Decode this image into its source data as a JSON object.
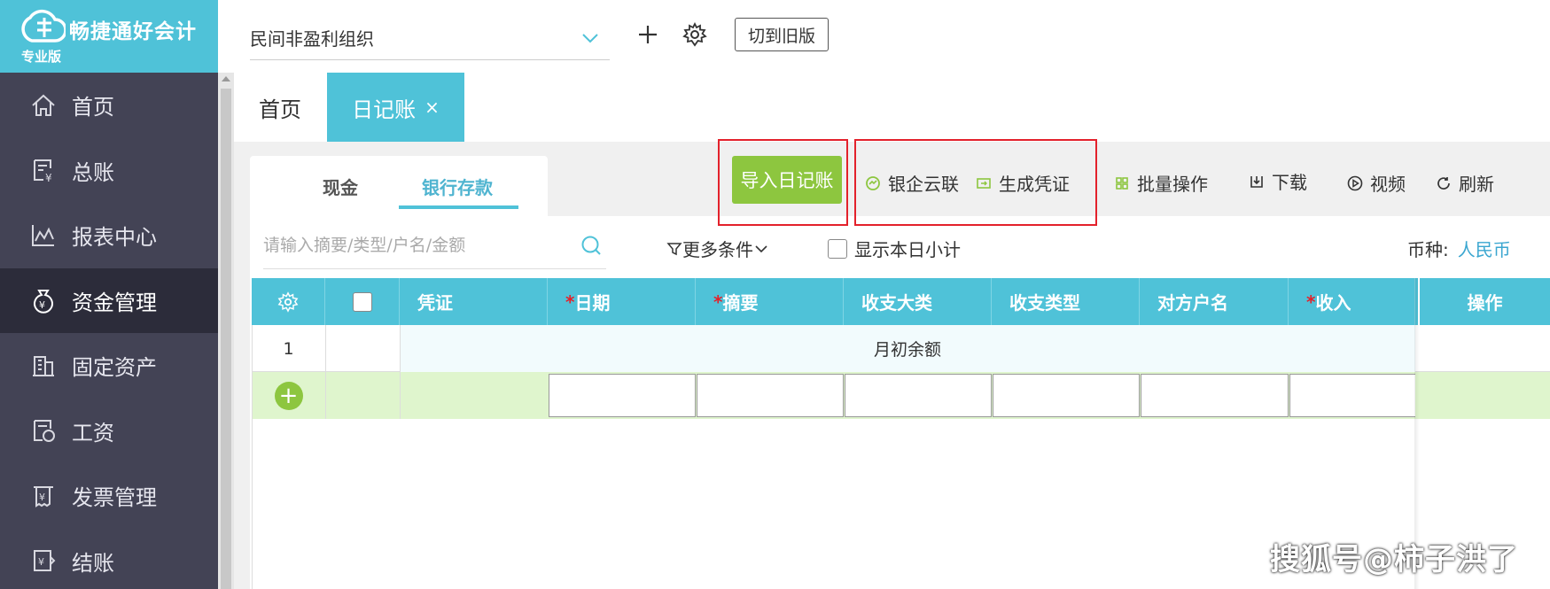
{
  "brand": {
    "name": "畅捷通好会计",
    "edition": "专业版"
  },
  "sidebar": {
    "items": [
      {
        "label": "首页",
        "icon": "home-icon"
      },
      {
        "label": "总账",
        "icon": "ledger-icon"
      },
      {
        "label": "报表中心",
        "icon": "chart-icon"
      },
      {
        "label": "资金管理",
        "icon": "money-bag-icon",
        "active": true
      },
      {
        "label": "固定资产",
        "icon": "building-icon"
      },
      {
        "label": "工资",
        "icon": "salary-icon"
      },
      {
        "label": "发票管理",
        "icon": "invoice-icon"
      },
      {
        "label": "结账",
        "icon": "closing-icon"
      }
    ]
  },
  "topbar": {
    "org_name": "民间非盈利组织",
    "old_version_label": "切到旧版"
  },
  "tabs": {
    "home": "首页",
    "journal": "日记账",
    "close": "×"
  },
  "subtabs": {
    "cash": "现金",
    "bank": "银行存款"
  },
  "toolbar": {
    "import": "导入日记账",
    "bank_link": "银企云联",
    "gen_voucher": "生成凭证",
    "batch": "批量操作",
    "download": "下载",
    "video": "视频",
    "refresh": "刷新"
  },
  "filters": {
    "search_placeholder": "请输入摘要/类型/户名/金额",
    "more": "更多条件",
    "show_daily": "显示本日小计",
    "currency_label": "币种:",
    "currency_value": "人民币"
  },
  "table": {
    "headers": {
      "voucher": "凭证",
      "date": "日期",
      "summary": "摘要",
      "category": "收支大类",
      "type": "收支类型",
      "counterparty": "对方户名",
      "income": "收入",
      "ops": "操作",
      "required_mark": "*"
    },
    "rows": [
      {
        "index": "1",
        "text": "月初余额"
      }
    ],
    "add_symbol": "+"
  },
  "watermark": "搜狐号@柿子洪了",
  "colors": {
    "accent": "#4fc2d8",
    "sidebar": "#434355",
    "green": "#8dc63f",
    "highlight": "#e3212b"
  }
}
